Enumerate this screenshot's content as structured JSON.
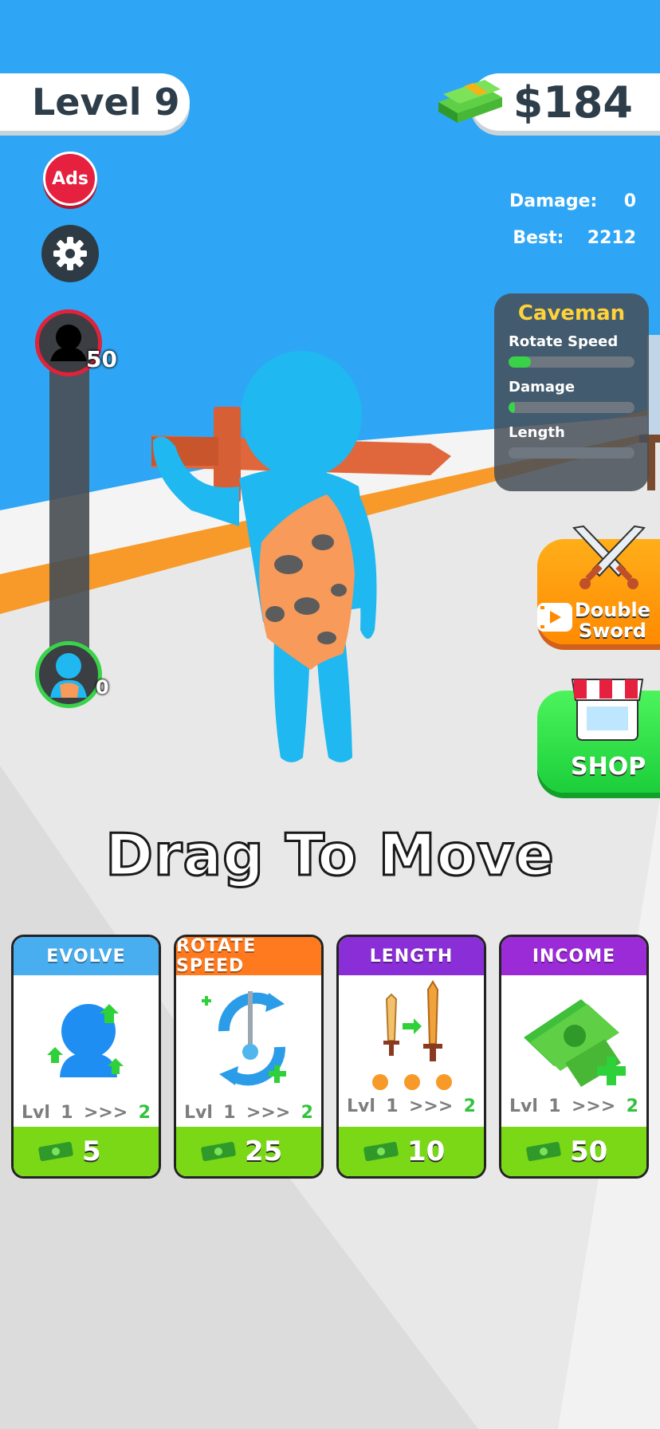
{
  "hud": {
    "level_label": "Level 9",
    "money": "$184",
    "ads_label": "Ads"
  },
  "stats": {
    "damage_label": "Damage:",
    "damage_value": "0",
    "best_label": "Best:",
    "best_value": "2212"
  },
  "evolution": {
    "top_value": "50",
    "bottom_value": "0"
  },
  "character_panel": {
    "name": "Caveman",
    "stats": [
      {
        "label": "Rotate Speed",
        "fill": 0.18
      },
      {
        "label": "Damage",
        "fill": 0.05
      },
      {
        "label": "Length",
        "fill": 0.0
      }
    ]
  },
  "side_buttons": {
    "double_sword_line1": "Double",
    "double_sword_line2": "Sword",
    "shop_label": "SHOP"
  },
  "hint": "Drag To Move",
  "cards": [
    {
      "title": "EVOLVE",
      "lvl_label": "Lvl",
      "from": "1",
      "arrows": ">>>",
      "to": "2",
      "price": "5",
      "color": "#49aef0"
    },
    {
      "title": "ROTATE SPEED",
      "lvl_label": "Lvl",
      "from": "1",
      "arrows": ">>>",
      "to": "2",
      "price": "25",
      "color": "#ff7a1f"
    },
    {
      "title": "LENGTH",
      "lvl_label": "Lvl",
      "from": "1",
      "arrows": ">>>",
      "to": "2",
      "price": "10",
      "color": "#8a2fd8"
    },
    {
      "title": "INCOME",
      "lvl_label": "Lvl",
      "from": "1",
      "arrows": ">>>",
      "to": "2",
      "price": "50",
      "color": "#9b2bd6"
    }
  ],
  "colors": {
    "sky": "#2ea6f5",
    "ground": "#ececec",
    "accent_orange": "#f79a2a",
    "character": "#1fb8f0"
  }
}
